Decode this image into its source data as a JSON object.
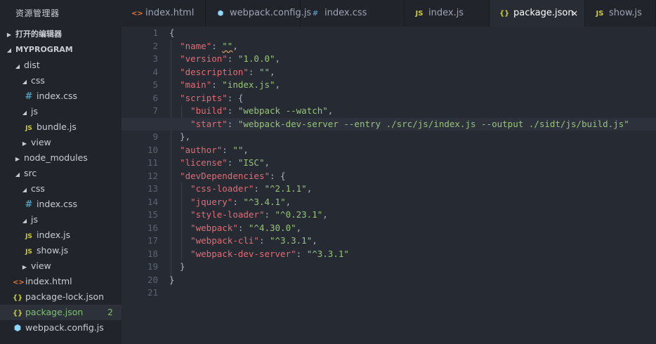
{
  "sidebar": {
    "title": "资源管理器",
    "items": [
      {
        "label": "打开的编辑器",
        "depth": 0,
        "arrow": "▶",
        "icon": "",
        "section": true
      },
      {
        "label": "MYPROGRAM",
        "depth": 0,
        "arrow": "◢",
        "icon": "",
        "section": true
      },
      {
        "label": "dist",
        "depth": 1,
        "arrow": "◢",
        "icon": ""
      },
      {
        "label": "css",
        "depth": 2,
        "arrow": "◢",
        "icon": ""
      },
      {
        "label": "index.css",
        "depth": 3,
        "arrow": "",
        "icon": "css"
      },
      {
        "label": "js",
        "depth": 2,
        "arrow": "◢",
        "icon": ""
      },
      {
        "label": "bundle.js",
        "depth": 3,
        "arrow": "",
        "icon": "js"
      },
      {
        "label": "view",
        "depth": 2,
        "arrow": "▶",
        "icon": ""
      },
      {
        "label": "node_modules",
        "depth": 1,
        "arrow": "▶",
        "icon": ""
      },
      {
        "label": "src",
        "depth": 1,
        "arrow": "◢",
        "icon": ""
      },
      {
        "label": "css",
        "depth": 2,
        "arrow": "◢",
        "icon": ""
      },
      {
        "label": "index.css",
        "depth": 3,
        "arrow": "",
        "icon": "css"
      },
      {
        "label": "js",
        "depth": 2,
        "arrow": "◢",
        "icon": ""
      },
      {
        "label": "index.js",
        "depth": 3,
        "arrow": "",
        "icon": "js"
      },
      {
        "label": "show.js",
        "depth": 3,
        "arrow": "",
        "icon": "js"
      },
      {
        "label": "view",
        "depth": 2,
        "arrow": "▶",
        "icon": ""
      },
      {
        "label": "index.html",
        "depth": 0,
        "arrow": "",
        "icon": "html"
      },
      {
        "label": "package-lock.json",
        "depth": 0,
        "arrow": "",
        "icon": "json"
      },
      {
        "label": "package.json",
        "depth": 0,
        "arrow": "",
        "icon": "json",
        "selected": true,
        "badge": "2"
      },
      {
        "label": "webpack.config.js",
        "depth": 0,
        "arrow": "",
        "icon": "webpack"
      }
    ]
  },
  "icons": {
    "html": "<>",
    "css": "#",
    "js": "JS",
    "json": "{}",
    "webpack": "⬢"
  },
  "tabs": [
    {
      "label": "index.html",
      "icon": "html",
      "active": false
    },
    {
      "label": "webpack.config.js",
      "icon": "webpack",
      "active": false
    },
    {
      "label": "index.css",
      "icon": "css",
      "active": false
    },
    {
      "label": "index.js",
      "icon": "js",
      "active": false
    },
    {
      "label": "package.json",
      "icon": "json",
      "active": true,
      "close": "×"
    },
    {
      "label": "show.js",
      "icon": "js",
      "active": false
    }
  ],
  "editor": {
    "active_line": 8,
    "lines": [
      [
        [
          "{",
          "p"
        ]
      ],
      [
        [
          "  ",
          "p"
        ],
        [
          "\"name\"",
          "key"
        ],
        [
          ": ",
          "p"
        ],
        [
          "\"\"",
          "strsq"
        ],
        [
          ",",
          "p"
        ]
      ],
      [
        [
          "  ",
          "p"
        ],
        [
          "\"version\"",
          "key"
        ],
        [
          ": ",
          "p"
        ],
        [
          "\"1.0.0\"",
          "str"
        ],
        [
          ",",
          "p"
        ]
      ],
      [
        [
          "  ",
          "p"
        ],
        [
          "\"description\"",
          "key"
        ],
        [
          ": ",
          "p"
        ],
        [
          "\"\"",
          "str"
        ],
        [
          ",",
          "p"
        ]
      ],
      [
        [
          "  ",
          "p"
        ],
        [
          "\"main\"",
          "key"
        ],
        [
          ": ",
          "p"
        ],
        [
          "\"index.js\"",
          "str"
        ],
        [
          ",",
          "p"
        ]
      ],
      [
        [
          "  ",
          "p"
        ],
        [
          "\"scripts\"",
          "key"
        ],
        [
          ": {",
          "p"
        ]
      ],
      [
        [
          "    ",
          "p"
        ],
        [
          "\"build\"",
          "key"
        ],
        [
          ": ",
          "p"
        ],
        [
          "\"webpack --watch\"",
          "str"
        ],
        [
          ",",
          "p"
        ]
      ],
      [
        [
          "    ",
          "p"
        ],
        [
          "\"start\"",
          "key"
        ],
        [
          ": ",
          "p"
        ],
        [
          "\"webpack-dev-server --entry ./src/js/index.js --output ./sidt/js/build.js\"",
          "str"
        ]
      ],
      [
        [
          "  },",
          "p"
        ]
      ],
      [
        [
          "  ",
          "p"
        ],
        [
          "\"author\"",
          "key"
        ],
        [
          ": ",
          "p"
        ],
        [
          "\"\"",
          "str"
        ],
        [
          ",",
          "p"
        ]
      ],
      [
        [
          "  ",
          "p"
        ],
        [
          "\"license\"",
          "key"
        ],
        [
          ": ",
          "p"
        ],
        [
          "\"ISC\"",
          "str"
        ],
        [
          ",",
          "p"
        ]
      ],
      [
        [
          "  ",
          "p"
        ],
        [
          "\"devDependencies\"",
          "key"
        ],
        [
          ": {",
          "p"
        ]
      ],
      [
        [
          "    ",
          "p"
        ],
        [
          "\"css-loader\"",
          "key"
        ],
        [
          ": ",
          "p"
        ],
        [
          "\"^2.1.1\"",
          "str"
        ],
        [
          ",",
          "p"
        ]
      ],
      [
        [
          "    ",
          "p"
        ],
        [
          "\"jquery\"",
          "key"
        ],
        [
          ": ",
          "p"
        ],
        [
          "\"^3.4.1\"",
          "str"
        ],
        [
          ",",
          "p"
        ]
      ],
      [
        [
          "    ",
          "p"
        ],
        [
          "\"style-loader\"",
          "key"
        ],
        [
          ": ",
          "p"
        ],
        [
          "\"^0.23.1\"",
          "str"
        ],
        [
          ",",
          "p"
        ]
      ],
      [
        [
          "    ",
          "p"
        ],
        [
          "\"webpack\"",
          "key"
        ],
        [
          ": ",
          "p"
        ],
        [
          "\"^4.30.0\"",
          "str"
        ],
        [
          ",",
          "p"
        ]
      ],
      [
        [
          "    ",
          "p"
        ],
        [
          "\"webpack-cli\"",
          "key"
        ],
        [
          ": ",
          "p"
        ],
        [
          "\"^3.3.1\"",
          "str"
        ],
        [
          ",",
          "p"
        ]
      ],
      [
        [
          "    ",
          "p"
        ],
        [
          "\"webpack-dev-server\"",
          "key"
        ],
        [
          ": ",
          "p"
        ],
        [
          "\"^3.3.1\"",
          "str"
        ]
      ],
      [
        [
          "  }",
          "p"
        ]
      ],
      [
        [
          "}",
          "p"
        ]
      ],
      [
        [
          "",
          "p"
        ]
      ]
    ]
  }
}
